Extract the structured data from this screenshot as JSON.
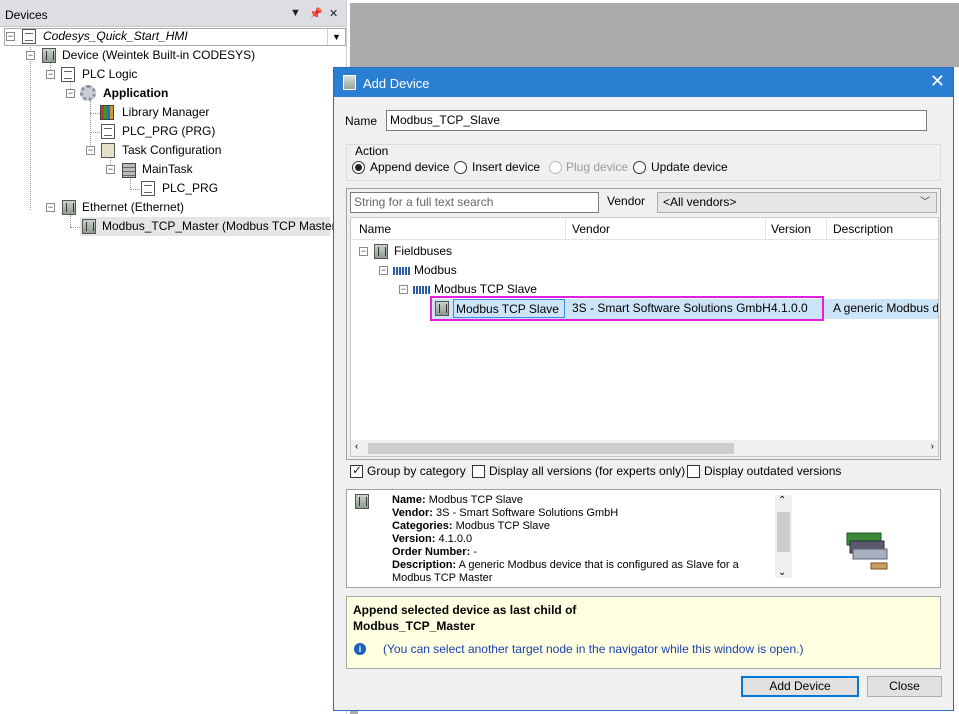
{
  "devices_panel": {
    "title": "Devices",
    "pin_icon": "pin-icon",
    "close_icon": "close-icon",
    "tree": {
      "project": "Codesys_Quick_Start_HMI",
      "device": "Device (Weintek Built-in CODESYS)",
      "plc_logic": "PLC Logic",
      "application": "Application",
      "library_manager": "Library Manager",
      "plc_prg": "PLC_PRG (PRG)",
      "task_configuration": "Task Configuration",
      "main_task": "MainTask",
      "main_task_plc_prg": "PLC_PRG",
      "ethernet": "Ethernet (Ethernet)",
      "modbus_master": "Modbus_TCP_Master (Modbus TCP Master)"
    }
  },
  "dialog": {
    "title": "Add Device",
    "name_label": "Name",
    "name_value": "Modbus_TCP_Slave",
    "action_label": "Action",
    "actions": {
      "append": "Append device",
      "insert": "Insert device",
      "plug": "Plug device",
      "update": "Update device"
    },
    "search_placeholder": "String for a full text search",
    "vendor_label": "Vendor",
    "vendor_value": "<All vendors>",
    "columns": {
      "name": "Name",
      "vendor": "Vendor",
      "version": "Version",
      "description": "Description"
    },
    "tree": {
      "fieldbuses": "Fieldbuses",
      "modbus": "Modbus",
      "modbus_tcp_slave_group": "Modbus TCP Slave"
    },
    "selected_row": {
      "name": "Modbus TCP Slave",
      "vendor": "3S - Smart Software Solutions GmbH",
      "version": "4.1.0.0",
      "description": "A generic Modbus dev"
    },
    "options": {
      "group_by_category": "Group by category",
      "display_all_versions": "Display all versions (for experts only)",
      "display_outdated": "Display outdated versions"
    },
    "info": {
      "name_label": "Name:",
      "name": "Modbus TCP Slave",
      "vendor_label": "Vendor:",
      "vendor": "3S - Smart Software Solutions GmbH",
      "categories_label": "Categories:",
      "categories": "Modbus TCP Slave",
      "version_label": "Version:",
      "version": "4.1.0.0",
      "order_label": "Order Number:",
      "order": "-",
      "description_label": "Description:",
      "description": "A generic Modbus device that is configured as Slave for a",
      "description_cont": "Modbus TCP Master"
    },
    "note": {
      "line1": "Append selected device as last child of",
      "line2": "Modbus_TCP_Master",
      "hint": "(You can select another target node in the navigator while this window is open.)"
    },
    "buttons": {
      "add": "Add Device",
      "close": "Close"
    }
  }
}
